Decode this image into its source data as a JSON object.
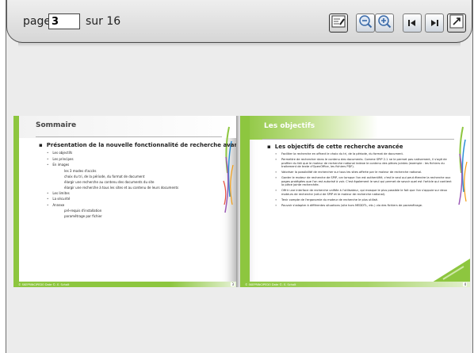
{
  "toolbar": {
    "page_label": "page",
    "current_page": "3",
    "total_label": "sur 16",
    "buttons": [
      {
        "name": "annotate-icon"
      },
      {
        "name": "zoom-out-icon"
      },
      {
        "name": "zoom-in-icon"
      },
      {
        "name": "first-page-icon"
      },
      {
        "name": "last-page-icon"
      },
      {
        "name": "fullscreen-icon"
      }
    ]
  },
  "left_page": {
    "title": "Sommaire",
    "heading": "Présentation de la nouvelle fonctionnalité de recherche avancée",
    "items": [
      "Les objectifs",
      "Les principes",
      "En images",
      "les 3 modes d'accès",
      "choix du tri, de la période, du format de document",
      "élargir une recherche au contenu des documents du site",
      "élargir une recherche à tous les sites et au contenu de leurs documents",
      "Les limites",
      "La sécurité",
      "Annexe",
      "pré-requis d'installation",
      "paramétrage par fichier"
    ],
    "footer": "© SKEPRINCIPEDO Date ©. E. Schalt",
    "page_number": "3"
  },
  "right_page": {
    "title": "Les objectifs",
    "heading": "Les objectifs de cette recherche avancée",
    "items": [
      "Faciliter la recherche en offrant le choix du tri, de la période, du format de document.",
      "Permettre de rechercher dans le contenu des documents. Comme SPIP 2.1 ne le permet pas nativement, il s'agit de profiter du fait que le moteur de recherche national indexe le contenu des pièces jointes (exemple : les fichiers du traitement de texte d'OpenOffice, les fichiers PDF).",
      "Valoriser la possibilité de rechercher sur tous les sites offerte par le moteur de recherche national.",
      "Garder le moteur de recherche de SPIP, car lorsque l'on est authentifié, c'est le seul qui peut étendre la recherche aux pages protégées que l'on est autorisé à voir. C'est également le seul qui permet de savoir quel est l'article qui contient la pièce jointe recherchée.",
      "Offrir une interface de recherche unifiée à l'utilisateur, qui masque le plus possible le fait que l'on s'appuie sur deux moteurs de recherche (celui de SPIP et le moteur de recherche national).",
      "Tenir compte de l'ergonomie du moteur de recherche le plus utilisé.",
      "Pouvoir s'adapter à différentes situations (site hors MEDDTL, etc.) via des fichiers de paramétrage."
    ],
    "footer": "© SKEPRINCIPEDO Date ©. E. Schalt",
    "page_number": "4"
  },
  "colors": {
    "accent_green": "#8dc63f",
    "toolbar_bg": "#e2e2e2",
    "viewer_bg": "#ececec"
  }
}
